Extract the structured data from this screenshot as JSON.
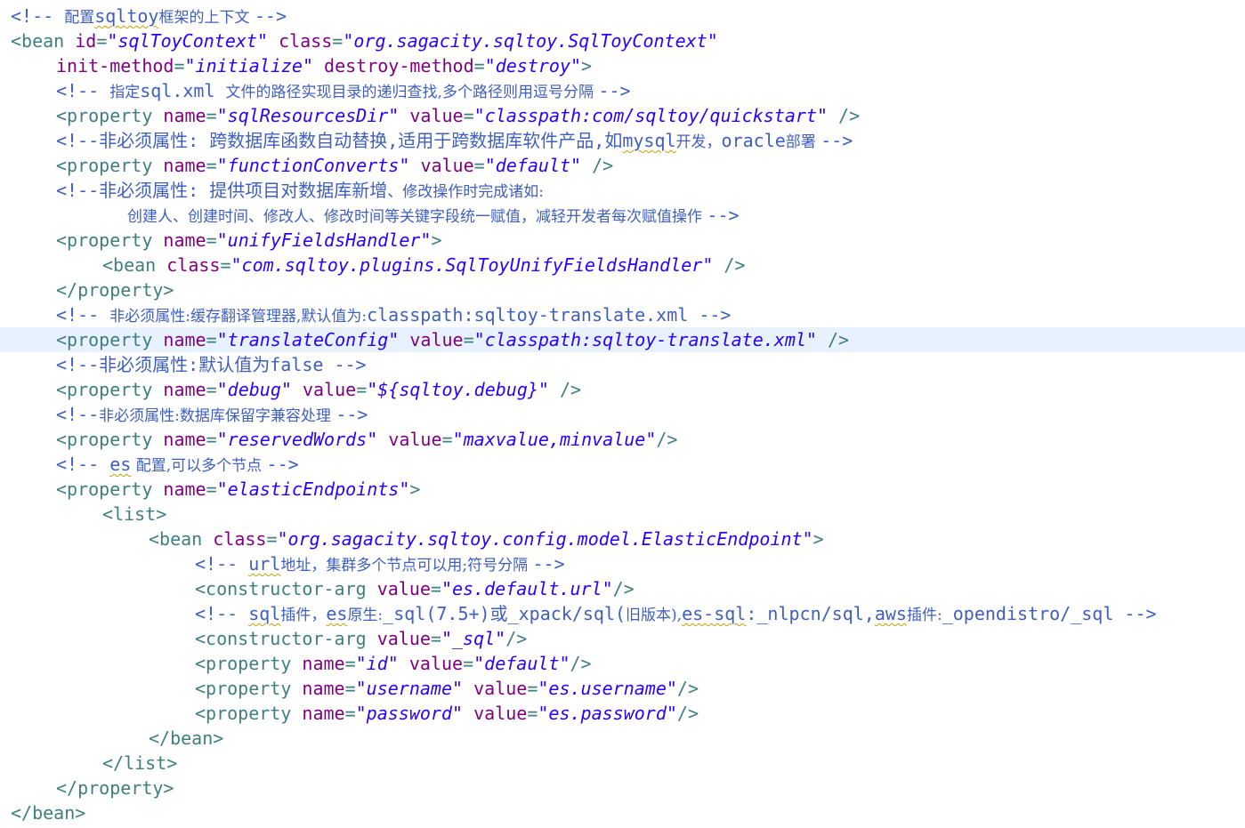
{
  "editor": {
    "colors": {
      "comment": "#3f5fbf",
      "tag": "#3f7f7f",
      "attribute": "#7f007f",
      "value": "#2a00ff",
      "current_line": "#e8f2fe"
    },
    "lines": [
      {
        "indent": 12,
        "tokens": [
          {
            "type": "comment",
            "text": "<!-- "
          },
          {
            "type": "comment-cjk",
            "text": "配置"
          },
          {
            "type": "comment",
            "text": "sqltoy",
            "squiggle": true
          },
          {
            "type": "comment-cjk",
            "text": "框架的上下文 "
          },
          {
            "type": "comment",
            "text": "-->"
          }
        ]
      },
      {
        "indent": 12,
        "tokens": [
          {
            "type": "tag",
            "text": "<bean "
          },
          {
            "type": "attr",
            "text": "id"
          },
          {
            "type": "tag",
            "text": "="
          },
          {
            "type": "val",
            "text": "\"sqlToyContext\""
          },
          {
            "type": "tag",
            "text": " "
          },
          {
            "type": "attr",
            "text": "class"
          },
          {
            "type": "tag",
            "text": "="
          },
          {
            "type": "val",
            "text": "\"org.sagacity.sqltoy.SqlToyContext\""
          }
        ]
      },
      {
        "indent": 63,
        "tokens": [
          {
            "type": "attr",
            "text": "init-method"
          },
          {
            "type": "tag",
            "text": "="
          },
          {
            "type": "val",
            "text": "\"initialize\""
          },
          {
            "type": "tag",
            "text": " "
          },
          {
            "type": "attr",
            "text": "destroy-method"
          },
          {
            "type": "tag",
            "text": "="
          },
          {
            "type": "val",
            "text": "\"destroy\""
          },
          {
            "type": "tag",
            "text": ">"
          }
        ]
      },
      {
        "indent": 63,
        "tokens": [
          {
            "type": "comment",
            "text": "<!-- "
          },
          {
            "type": "comment-cjk",
            "text": "指定"
          },
          {
            "type": "comment",
            "text": "sql.xml "
          },
          {
            "type": "comment-cjk",
            "text": "文件的路径实现目录的递归查找,多个路径则用逗号分隔 "
          },
          {
            "type": "comment",
            "text": "-->"
          }
        ]
      },
      {
        "indent": 63,
        "tokens": [
          {
            "type": "tag",
            "text": "<property "
          },
          {
            "type": "attr",
            "text": "name"
          },
          {
            "type": "tag",
            "text": "="
          },
          {
            "type": "val",
            "text": "\"sqlResourcesDir\""
          },
          {
            "type": "tag",
            "text": " "
          },
          {
            "type": "attr",
            "text": "value"
          },
          {
            "type": "tag",
            "text": "="
          },
          {
            "type": "val",
            "text": "\"classpath:com/sqltoy/quickstart\""
          },
          {
            "type": "tag",
            "text": " />"
          }
        ]
      },
      {
        "indent": 63,
        "tokens": [
          {
            "type": "comment",
            "text": "<!--非必须属性: 跨数据库函数自动替换,适用于跨数据库软件产品,如"
          },
          {
            "type": "comment",
            "text": "mysql",
            "squiggle": true
          },
          {
            "type": "comment-cjk",
            "text": "开发，"
          },
          {
            "type": "comment",
            "text": "oracle"
          },
          {
            "type": "comment-cjk",
            "text": "部署 "
          },
          {
            "type": "comment",
            "text": "-->"
          }
        ]
      },
      {
        "indent": 63,
        "tokens": [
          {
            "type": "tag",
            "text": "<property "
          },
          {
            "type": "attr",
            "text": "name"
          },
          {
            "type": "tag",
            "text": "="
          },
          {
            "type": "val",
            "text": "\"functionConverts\""
          },
          {
            "type": "tag",
            "text": " "
          },
          {
            "type": "attr",
            "text": "value"
          },
          {
            "type": "tag",
            "text": "="
          },
          {
            "type": "val",
            "text": "\"default\""
          },
          {
            "type": "tag",
            "text": " />"
          }
        ]
      },
      {
        "indent": 63,
        "tokens": [
          {
            "type": "comment",
            "text": "<!--非必须属性: 提供项目对数据库新增"
          },
          {
            "type": "comment-cjk",
            "text": "、修改操作时完成诸如:"
          }
        ]
      },
      {
        "indent": 143,
        "tokens": [
          {
            "type": "comment-cjk",
            "text": "创建人、创建时间、修改人、修改时间等关键字段统一赋值，减轻开发者每次赋值操作 "
          },
          {
            "type": "comment",
            "text": "-->"
          }
        ]
      },
      {
        "indent": 63,
        "tokens": [
          {
            "type": "tag",
            "text": "<property "
          },
          {
            "type": "attr",
            "text": "name"
          },
          {
            "type": "tag",
            "text": "="
          },
          {
            "type": "val",
            "text": "\"unifyFieldsHandler\""
          },
          {
            "type": "tag",
            "text": ">"
          }
        ]
      },
      {
        "indent": 115,
        "tokens": [
          {
            "type": "tag",
            "text": "<bean "
          },
          {
            "type": "attr",
            "text": "class"
          },
          {
            "type": "tag",
            "text": "="
          },
          {
            "type": "val",
            "text": "\"com.sqltoy.plugins.SqlToyUnifyFieldsHandler\""
          },
          {
            "type": "tag",
            "text": " />"
          }
        ]
      },
      {
        "indent": 63,
        "tokens": [
          {
            "type": "tag",
            "text": "</property>"
          }
        ]
      },
      {
        "indent": 63,
        "tokens": [
          {
            "type": "comment",
            "text": "<!-- "
          },
          {
            "type": "comment-cjk",
            "text": "非必须属性:缓存翻译管理器,默认值为:"
          },
          {
            "type": "comment",
            "text": "classpath:sqltoy-translate.xml -->"
          }
        ]
      },
      {
        "indent": 63,
        "highlight": true,
        "tokens": [
          {
            "type": "tag",
            "text": "<property "
          },
          {
            "type": "attr",
            "text": "name"
          },
          {
            "type": "tag",
            "text": "="
          },
          {
            "type": "val",
            "text": "\"translateConfig\""
          },
          {
            "type": "tag",
            "text": " "
          },
          {
            "type": "attr",
            "text": "value"
          },
          {
            "type": "tag",
            "text": "="
          },
          {
            "type": "val",
            "text": "\"classpath:sqltoy-translate.xml\""
          },
          {
            "type": "tag",
            "text": " />"
          }
        ]
      },
      {
        "indent": 63,
        "tokens": [
          {
            "type": "comment",
            "text": "<!--非必须属性:默认值为false -->"
          }
        ]
      },
      {
        "indent": 63,
        "tokens": [
          {
            "type": "tag",
            "text": "<property "
          },
          {
            "type": "attr",
            "text": "name"
          },
          {
            "type": "tag",
            "text": "="
          },
          {
            "type": "val",
            "text": "\"debug\""
          },
          {
            "type": "tag",
            "text": " "
          },
          {
            "type": "attr",
            "text": "value"
          },
          {
            "type": "tag",
            "text": "="
          },
          {
            "type": "val",
            "text": "\"${sqltoy.debug}\""
          },
          {
            "type": "tag",
            "text": " />"
          }
        ]
      },
      {
        "indent": 63,
        "tokens": [
          {
            "type": "comment",
            "text": "<!--"
          },
          {
            "type": "comment-cjk",
            "text": "非必须属性:数据库保留字兼容处理 "
          },
          {
            "type": "comment",
            "text": "-->"
          }
        ]
      },
      {
        "indent": 63,
        "tokens": [
          {
            "type": "tag",
            "text": "<property "
          },
          {
            "type": "attr",
            "text": "name"
          },
          {
            "type": "tag",
            "text": "="
          },
          {
            "type": "val",
            "text": "\"reservedWords\""
          },
          {
            "type": "tag",
            "text": " "
          },
          {
            "type": "attr",
            "text": "value"
          },
          {
            "type": "tag",
            "text": "="
          },
          {
            "type": "val",
            "text": "\"maxvalue,minvalue\""
          },
          {
            "type": "tag",
            "text": "/>"
          }
        ]
      },
      {
        "indent": 63,
        "tokens": [
          {
            "type": "comment",
            "text": "<!-- "
          },
          {
            "type": "comment",
            "text": "es",
            "squiggle": true
          },
          {
            "type": "comment-cjk",
            "text": " 配置,可以多个节点 "
          },
          {
            "type": "comment",
            "text": "-->"
          }
        ]
      },
      {
        "indent": 63,
        "tokens": [
          {
            "type": "tag",
            "text": "<property "
          },
          {
            "type": "attr",
            "text": "name"
          },
          {
            "type": "tag",
            "text": "="
          },
          {
            "type": "val",
            "text": "\"elasticEndpoints\""
          },
          {
            "type": "tag",
            "text": ">"
          }
        ]
      },
      {
        "indent": 115,
        "tokens": [
          {
            "type": "tag",
            "text": "<list>"
          }
        ]
      },
      {
        "indent": 167,
        "tokens": [
          {
            "type": "tag",
            "text": "<bean "
          },
          {
            "type": "attr",
            "text": "class"
          },
          {
            "type": "tag",
            "text": "="
          },
          {
            "type": "val",
            "text": "\"org.sagacity.sqltoy.config.model.ElasticEndpoint\""
          },
          {
            "type": "tag",
            "text": ">"
          }
        ]
      },
      {
        "indent": 219,
        "tokens": [
          {
            "type": "comment",
            "text": "<!-- "
          },
          {
            "type": "comment",
            "text": "url",
            "squiggle": true
          },
          {
            "type": "comment-cjk",
            "text": "地址，集群多个节点可以用;符号分隔 "
          },
          {
            "type": "comment",
            "text": "-->"
          }
        ]
      },
      {
        "indent": 219,
        "tokens": [
          {
            "type": "tag",
            "text": "<constructor-arg "
          },
          {
            "type": "attr",
            "text": "value"
          },
          {
            "type": "tag",
            "text": "="
          },
          {
            "type": "val",
            "text": "\"es.default.url\""
          },
          {
            "type": "tag",
            "text": "/>"
          }
        ]
      },
      {
        "indent": 219,
        "tokens": [
          {
            "type": "comment",
            "text": "<!-- "
          },
          {
            "type": "comment",
            "text": "sql",
            "squiggle": true
          },
          {
            "type": "comment-cjk",
            "text": "插件，"
          },
          {
            "type": "comment",
            "text": "es",
            "squiggle": true
          },
          {
            "type": "comment-cjk",
            "text": "原生:"
          },
          {
            "type": "comment",
            "text": "_sql(7.5+)或_xpack/sql("
          },
          {
            "type": "comment-cjk",
            "text": "旧版本),"
          },
          {
            "type": "comment",
            "text": "es-sql",
            "squiggle": true
          },
          {
            "type": "comment",
            "text": ":_nlpcn/sql,"
          },
          {
            "type": "comment",
            "text": "aws",
            "squiggle": true
          },
          {
            "type": "comment-cjk",
            "text": "插件:"
          },
          {
            "type": "comment",
            "text": "_opendistro/_sql -->"
          }
        ]
      },
      {
        "indent": 219,
        "tokens": [
          {
            "type": "tag",
            "text": "<constructor-arg "
          },
          {
            "type": "attr",
            "text": "value"
          },
          {
            "type": "tag",
            "text": "="
          },
          {
            "type": "val",
            "text": "\"_sql\""
          },
          {
            "type": "tag",
            "text": "/>"
          }
        ]
      },
      {
        "indent": 219,
        "tokens": [
          {
            "type": "tag",
            "text": "<property "
          },
          {
            "type": "attr",
            "text": "name"
          },
          {
            "type": "tag",
            "text": "="
          },
          {
            "type": "val",
            "text": "\"id\""
          },
          {
            "type": "tag",
            "text": " "
          },
          {
            "type": "attr",
            "text": "value"
          },
          {
            "type": "tag",
            "text": "="
          },
          {
            "type": "val",
            "text": "\"default\""
          },
          {
            "type": "tag",
            "text": "/>"
          }
        ]
      },
      {
        "indent": 219,
        "tokens": [
          {
            "type": "tag",
            "text": "<property "
          },
          {
            "type": "attr",
            "text": "name"
          },
          {
            "type": "tag",
            "text": "="
          },
          {
            "type": "val",
            "text": "\"username\""
          },
          {
            "type": "tag",
            "text": " "
          },
          {
            "type": "attr",
            "text": "value"
          },
          {
            "type": "tag",
            "text": "="
          },
          {
            "type": "val",
            "text": "\"es.username\""
          },
          {
            "type": "tag",
            "text": "/>"
          }
        ]
      },
      {
        "indent": 219,
        "tokens": [
          {
            "type": "tag",
            "text": "<property "
          },
          {
            "type": "attr",
            "text": "name"
          },
          {
            "type": "tag",
            "text": "="
          },
          {
            "type": "val",
            "text": "\"password\""
          },
          {
            "type": "tag",
            "text": " "
          },
          {
            "type": "attr",
            "text": "value"
          },
          {
            "type": "tag",
            "text": "="
          },
          {
            "type": "val",
            "text": "\"es.password\""
          },
          {
            "type": "tag",
            "text": "/>"
          }
        ]
      },
      {
        "indent": 167,
        "tokens": [
          {
            "type": "tag",
            "text": "</bean>"
          }
        ]
      },
      {
        "indent": 115,
        "tokens": [
          {
            "type": "tag",
            "text": "</list>"
          }
        ]
      },
      {
        "indent": 63,
        "tokens": [
          {
            "type": "tag",
            "text": "</property>"
          }
        ]
      },
      {
        "indent": 12,
        "tokens": [
          {
            "type": "tag",
            "text": "</bean>"
          }
        ]
      }
    ]
  }
}
